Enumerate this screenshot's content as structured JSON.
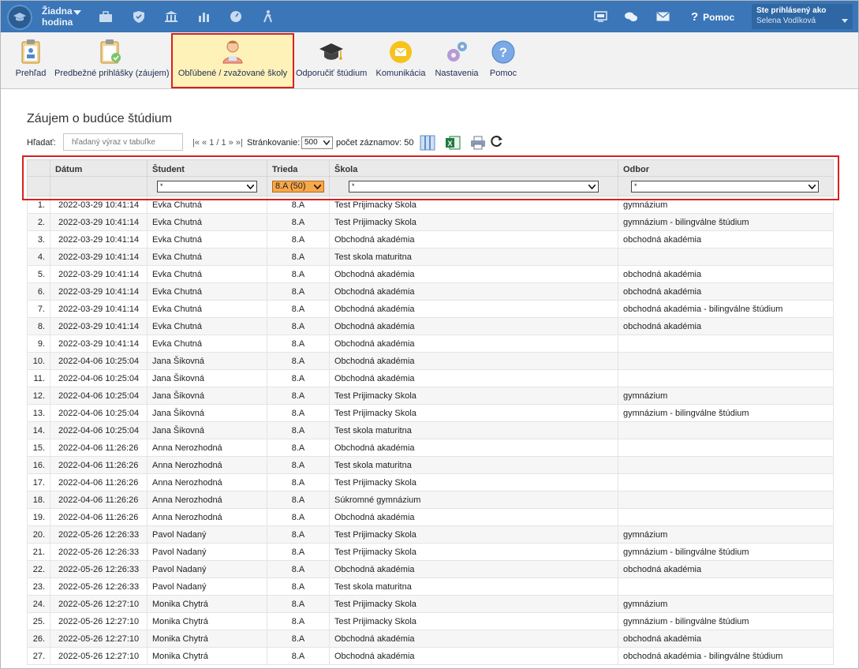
{
  "topbar": {
    "hour_line1": "Žiadna",
    "hour_line2": "hodina",
    "help_label": "Pomoc",
    "user_label": "Ste prihlásený ako",
    "user_name": "Selena Vodíková"
  },
  "toolbar": {
    "items": [
      {
        "label": "Prehľad",
        "icon": "clipboard-person-icon"
      },
      {
        "label": "Predbežné prihlášky (záujem)",
        "icon": "clipboard-check-icon"
      },
      {
        "label": "Obľúbené / zvažované školy",
        "icon": "student-person-icon"
      },
      {
        "label": "Odporučiť štúdium",
        "icon": "graduation-cap-icon"
      },
      {
        "label": "Komunikácia",
        "icon": "envelope-icon"
      },
      {
        "label": "Nastavenia",
        "icon": "gears-icon"
      },
      {
        "label": "Pomoc",
        "icon": "question-icon"
      }
    ],
    "active_index": 2
  },
  "page": {
    "title": "Záujem o budúce štúdium",
    "search_label": "Hľadať:",
    "search_placeholder": "hľadaný výraz v tabuľke",
    "pager_text": "|« « 1 / 1 » »|",
    "page_size_label": "Stránkovanie:",
    "page_size_value": "500",
    "record_count": "počet záznamov: 50"
  },
  "table": {
    "columns": [
      "",
      "Dátum",
      "Študent",
      "Trieda",
      "Škola",
      "Odbor"
    ],
    "filters": {
      "student": "*",
      "trieda": "8.A (50)",
      "skola": "*",
      "odbor": "*"
    },
    "rows": [
      [
        "1.",
        "2022-03-29 10:41:14",
        "Evka Chutná",
        "8.A",
        "Test Prijimacky Skola",
        "gymnázium"
      ],
      [
        "2.",
        "2022-03-29 10:41:14",
        "Evka Chutná",
        "8.A",
        "Test Prijimacky Skola",
        "gymnázium - bilingválne štúdium"
      ],
      [
        "3.",
        "2022-03-29 10:41:14",
        "Evka Chutná",
        "8.A",
        "Obchodná akadémia",
        "obchodná akadémia"
      ],
      [
        "4.",
        "2022-03-29 10:41:14",
        "Evka Chutná",
        "8.A",
        "Test skola maturitna",
        ""
      ],
      [
        "5.",
        "2022-03-29 10:41:14",
        "Evka Chutná",
        "8.A",
        "Obchodná akadémia",
        "obchodná akadémia"
      ],
      [
        "6.",
        "2022-03-29 10:41:14",
        "Evka Chutná",
        "8.A",
        "Obchodná akadémia",
        "obchodná akadémia"
      ],
      [
        "7.",
        "2022-03-29 10:41:14",
        "Evka Chutná",
        "8.A",
        "Obchodná akadémia",
        "obchodná akadémia - bilingválne štúdium"
      ],
      [
        "8.",
        "2022-03-29 10:41:14",
        "Evka Chutná",
        "8.A",
        "Obchodná akadémia",
        "obchodná akadémia"
      ],
      [
        "9.",
        "2022-03-29 10:41:14",
        "Evka Chutná",
        "8.A",
        "Obchodná akadémia",
        ""
      ],
      [
        "10.",
        "2022-04-06 10:25:04",
        "Jana Šikovná",
        "8.A",
        "Obchodná akadémia",
        ""
      ],
      [
        "11.",
        "2022-04-06 10:25:04",
        "Jana Šikovná",
        "8.A",
        "Obchodná akadémia",
        ""
      ],
      [
        "12.",
        "2022-04-06 10:25:04",
        "Jana Šikovná",
        "8.A",
        "Test Prijimacky Skola",
        "gymnázium"
      ],
      [
        "13.",
        "2022-04-06 10:25:04",
        "Jana Šikovná",
        "8.A",
        "Test Prijimacky Skola",
        "gymnázium - bilingválne štúdium"
      ],
      [
        "14.",
        "2022-04-06 10:25:04",
        "Jana Šikovná",
        "8.A",
        "Test skola maturitna",
        ""
      ],
      [
        "15.",
        "2022-04-06 11:26:26",
        "Anna Nerozhodná",
        "8.A",
        "Obchodná akadémia",
        ""
      ],
      [
        "16.",
        "2022-04-06 11:26:26",
        "Anna Nerozhodná",
        "8.A",
        "Test skola maturitna",
        ""
      ],
      [
        "17.",
        "2022-04-06 11:26:26",
        "Anna Nerozhodná",
        "8.A",
        "Test Prijimacky Skola",
        ""
      ],
      [
        "18.",
        "2022-04-06 11:26:26",
        "Anna Nerozhodná",
        "8.A",
        "Súkromné gymnázium",
        ""
      ],
      [
        "19.",
        "2022-04-06 11:26:26",
        "Anna Nerozhodná",
        "8.A",
        "Obchodná akadémia",
        ""
      ],
      [
        "20.",
        "2022-05-26 12:26:33",
        "Pavol Nadaný",
        "8.A",
        "Test Prijimacky Skola",
        "gymnázium"
      ],
      [
        "21.",
        "2022-05-26 12:26:33",
        "Pavol Nadaný",
        "8.A",
        "Test Prijimacky Skola",
        "gymnázium - bilingválne štúdium"
      ],
      [
        "22.",
        "2022-05-26 12:26:33",
        "Pavol Nadaný",
        "8.A",
        "Obchodná akadémia",
        "obchodná akadémia"
      ],
      [
        "23.",
        "2022-05-26 12:26:33",
        "Pavol Nadaný",
        "8.A",
        "Test skola maturitna",
        ""
      ],
      [
        "24.",
        "2022-05-26 12:27:10",
        "Monika Chytrá",
        "8.A",
        "Test Prijimacky Skola",
        "gymnázium"
      ],
      [
        "25.",
        "2022-05-26 12:27:10",
        "Monika Chytrá",
        "8.A",
        "Test Prijimacky Skola",
        "gymnázium - bilingválne štúdium"
      ],
      [
        "26.",
        "2022-05-26 12:27:10",
        "Monika Chytrá",
        "8.A",
        "Obchodná akadémia",
        "obchodná akadémia"
      ],
      [
        "27.",
        "2022-05-26 12:27:10",
        "Monika Chytrá",
        "8.A",
        "Obchodná akadémia",
        "obchodná akadémia - bilingválne štúdium"
      ]
    ]
  },
  "colors": {
    "topbar": "#3a76b8",
    "highlight": "#d9201f",
    "active_tab": "#fff2b8",
    "filter_active": "#f8a74a"
  }
}
